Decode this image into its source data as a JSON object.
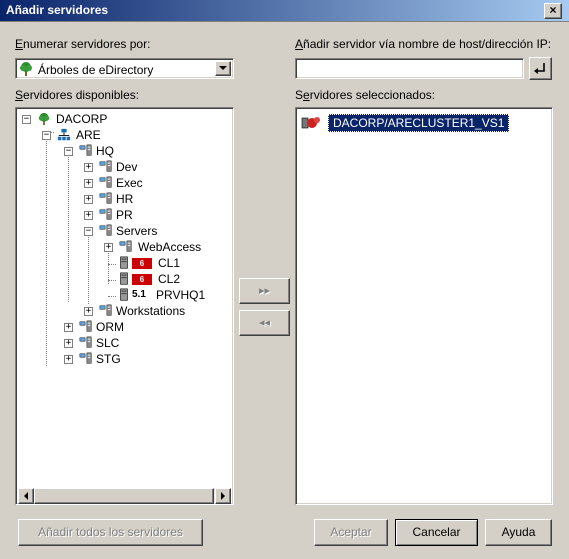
{
  "window": {
    "title": "Añadir servidores",
    "close_glyph": "×"
  },
  "left": {
    "enumerate_label_u": "E",
    "enumerate_label_rest": "numerar servidores por:",
    "combo_value": "Árboles de eDirectory",
    "available_label_u": "S",
    "available_label_rest": "ervidores disponibles:"
  },
  "right": {
    "host_label_u": "A",
    "host_label_rest": "ñadir servidor vía nombre de host/dirección IP:",
    "host_input_value": "",
    "selected_label_first": "S",
    "selected_label_u": "e",
    "selected_label_rest": "rvidores seleccionados:",
    "selected_items": [
      {
        "label": "DACORP/ARECLUSTER1_VS1"
      }
    ]
  },
  "tree": [
    {
      "label": "DACORP",
      "icon": "tree-icon"
    },
    {
      "label": "ARE",
      "icon": "org-icon"
    },
    {
      "label": "HQ",
      "icon": "ou-icon"
    },
    {
      "label": "Dev",
      "icon": "ou-icon"
    },
    {
      "label": "Exec",
      "icon": "ou-icon"
    },
    {
      "label": "HR",
      "icon": "ou-icon"
    },
    {
      "label": "PR",
      "icon": "ou-icon"
    },
    {
      "label": "Servers",
      "icon": "ou-icon"
    },
    {
      "label": "WebAccess",
      "icon": "ou-icon"
    },
    {
      "label": "CL1",
      "icon": "server-icon",
      "badge": "6"
    },
    {
      "label": "CL2",
      "icon": "server-icon",
      "badge": "6"
    },
    {
      "label": "PRVHQ1",
      "icon": "server-icon",
      "badge": "5.1"
    },
    {
      "label": "Workstations",
      "icon": "ou-icon"
    },
    {
      "label": "ORM",
      "icon": "ou-icon"
    },
    {
      "label": "SLC",
      "icon": "ou-icon"
    },
    {
      "label": "STG",
      "icon": "ou-icon"
    }
  ],
  "buttons": {
    "add_all": "Añadir todos los servidores",
    "accept": "Aceptar",
    "cancel": "Cancelar",
    "help": "Ayuda",
    "move_right": "▸▸",
    "move_left": "◂◂"
  },
  "colors": {
    "badge_red": "#cc0000",
    "selection": "#0a246a"
  }
}
